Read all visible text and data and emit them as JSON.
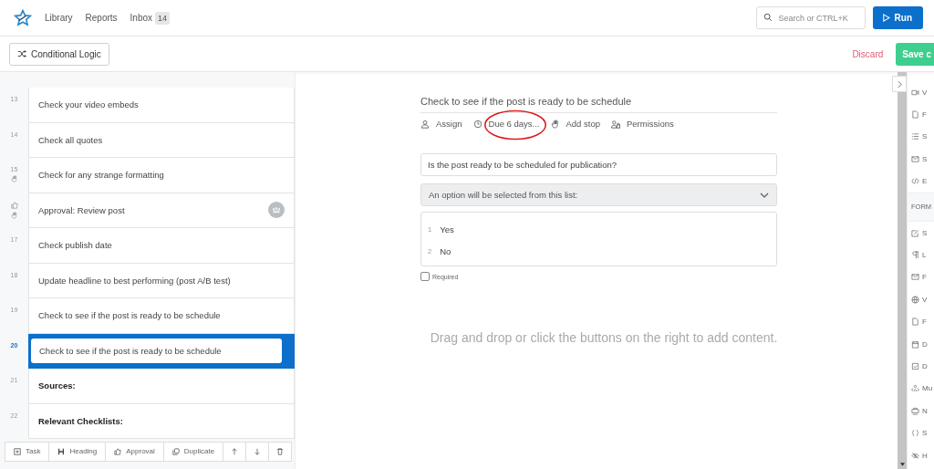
{
  "nav": {
    "items": [
      {
        "label": "Library"
      },
      {
        "label": "Reports"
      },
      {
        "label": "Inbox",
        "badge": "14"
      }
    ],
    "search": {
      "placeholder": "Search or CTRL+K"
    },
    "run_button": "Run"
  },
  "toolbar": {
    "conditional_logic": "Conditional Logic",
    "discard": "Discard",
    "save": "Save c"
  },
  "steps": [
    {
      "number": "13",
      "text": "Check your video embeds",
      "kind": "task",
      "stop": false,
      "selected": false
    },
    {
      "number": "14",
      "text": "Check all quotes",
      "kind": "task",
      "stop": false,
      "selected": false
    },
    {
      "number": "15",
      "text": "Check for any strange formatting",
      "kind": "task",
      "stop": true,
      "selected": false
    },
    {
      "text": "Approval: Review post",
      "kind": "approval",
      "stop": true,
      "selected": false
    },
    {
      "number": "17",
      "text": "Check publish date",
      "kind": "task",
      "stop": false,
      "selected": false
    },
    {
      "number": "18",
      "text": "Update headline to best performing (post A/B test)",
      "kind": "task",
      "stop": false,
      "selected": false
    },
    {
      "number": "19",
      "text": "Check to see if the post is ready to be schedule",
      "kind": "task",
      "stop": false,
      "selected": false
    },
    {
      "number": "20",
      "text": "Check to see if the post is ready to be schedule",
      "kind": "task",
      "stop": false,
      "selected": true
    },
    {
      "number": "21",
      "text": "Sources:",
      "kind": "heading",
      "stop": false,
      "selected": false
    },
    {
      "number": "22",
      "text": "Relevant Checklists:",
      "kind": "heading",
      "stop": false,
      "selected": false
    }
  ],
  "bottom_toolbar": [
    {
      "kind": "task",
      "label": "Task"
    },
    {
      "kind": "heading",
      "label": "Heading"
    },
    {
      "kind": "approval",
      "label": "Approval"
    },
    {
      "kind": "duplicate",
      "label": "Duplicate"
    },
    {
      "kind": "up"
    },
    {
      "kind": "down"
    },
    {
      "kind": "delete"
    }
  ],
  "editor": {
    "title": "Check to see if the post is ready to be schedule",
    "actions": [
      {
        "kind": "assign",
        "label": "Assign"
      },
      {
        "kind": "due",
        "label": "Due 6 days..."
      },
      {
        "kind": "stop",
        "label": "Add stop"
      },
      {
        "kind": "permissions",
        "label": "Permissions"
      }
    ],
    "question": "Is the post ready to be scheduled for publication?",
    "dropdown": "An option will be selected from this list:",
    "options": [
      {
        "number": "1",
        "label": "Yes"
      },
      {
        "number": "2",
        "label": "No"
      }
    ],
    "required": {
      "label": "Required",
      "checked": false
    },
    "empty_hint": "Drag and drop or click the buttons on the right to add content."
  },
  "content_panel": [
    {
      "kind": "item",
      "label": "V"
    },
    {
      "kind": "item",
      "label": "F"
    },
    {
      "kind": "item",
      "label": "S"
    },
    {
      "kind": "item",
      "label": "S"
    },
    {
      "kind": "item",
      "label": "E"
    },
    {
      "kind": "header",
      "label": "FORM"
    },
    {
      "kind": "item",
      "label": "S"
    },
    {
      "kind": "item",
      "label": "L"
    },
    {
      "kind": "item",
      "label": "F"
    },
    {
      "kind": "item",
      "label": "V"
    },
    {
      "kind": "item",
      "label": "F"
    },
    {
      "kind": "item",
      "label": "D"
    },
    {
      "kind": "item",
      "label": "D"
    },
    {
      "kind": "item",
      "label": "Mu"
    },
    {
      "kind": "item",
      "label": "N"
    },
    {
      "kind": "item",
      "label": "S"
    },
    {
      "kind": "item",
      "label": "H"
    }
  ]
}
